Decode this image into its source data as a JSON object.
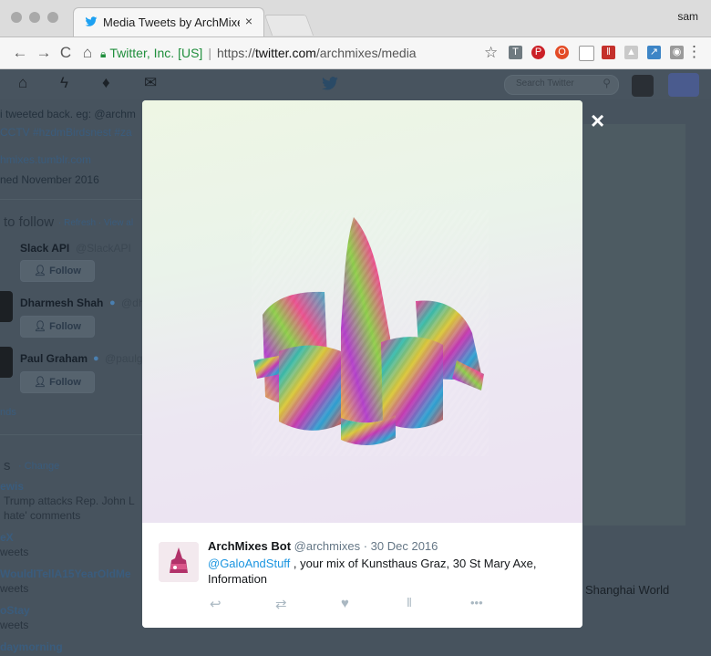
{
  "browser": {
    "tab_title": "Media Tweets by ArchMixes Bo",
    "tab_close": "×",
    "user": "sam",
    "url_secure_label": "Twitter, Inc. [US]",
    "url_scheme": "https://",
    "url_host": "twitter.com",
    "url_path": "/archmixes/media"
  },
  "twitter_nav": {
    "search_placeholder": "Search Twitter"
  },
  "sidebar": {
    "bio_lines": [
      "i tweeted back. eg: @archm",
      "CCTV #hzdmBirdsnest #za"
    ],
    "website": "hmixes.tumblr.com",
    "joined": "ned November 2016",
    "who_to_follow": "to follow",
    "refresh": "· Refresh · View al",
    "follow_suggestions": [
      {
        "name": "Slack API",
        "handle": "@SlackAPI",
        "button": "Follow"
      },
      {
        "name": "Dharmesh Shah",
        "handle": "@dh",
        "button": "Follow"
      },
      {
        "name": "Paul Graham",
        "handle": "@paulg",
        "button": "Follow"
      }
    ],
    "find_friends": "nds",
    "trends_header": "s",
    "trends_change": "· Change",
    "trends": [
      {
        "name": "ewis",
        "desc": "Trump attacks Rep. John L",
        "desc2": "hate' comments"
      },
      {
        "name": "eX",
        "desc": "weets"
      },
      {
        "name": "WouldITellA15YearOldMe",
        "desc": "weets"
      },
      {
        "name": "oStay",
        "desc": "weets"
      },
      {
        "name": "daymorning",
        "desc": ""
      }
    ]
  },
  "right_panel": {
    "snippet": "Shanghai World"
  },
  "modal": {
    "close": "×",
    "tweet": {
      "name": "ArchMixes Bot",
      "handle": "@archmixes",
      "date": "· 30 Dec 2016",
      "mention": "@GaloAndStuff",
      "text": " , your mix of Kunsthaus Graz, 30 St Mary Axe, Information"
    },
    "actions": [
      "reply-icon",
      "retweet-icon",
      "like-icon",
      "analytics-icon",
      "more-icon"
    ]
  },
  "colors": {
    "twitter_blue": "#1da1f2",
    "overlay": "#47535e",
    "mention": "#1b95e0"
  }
}
